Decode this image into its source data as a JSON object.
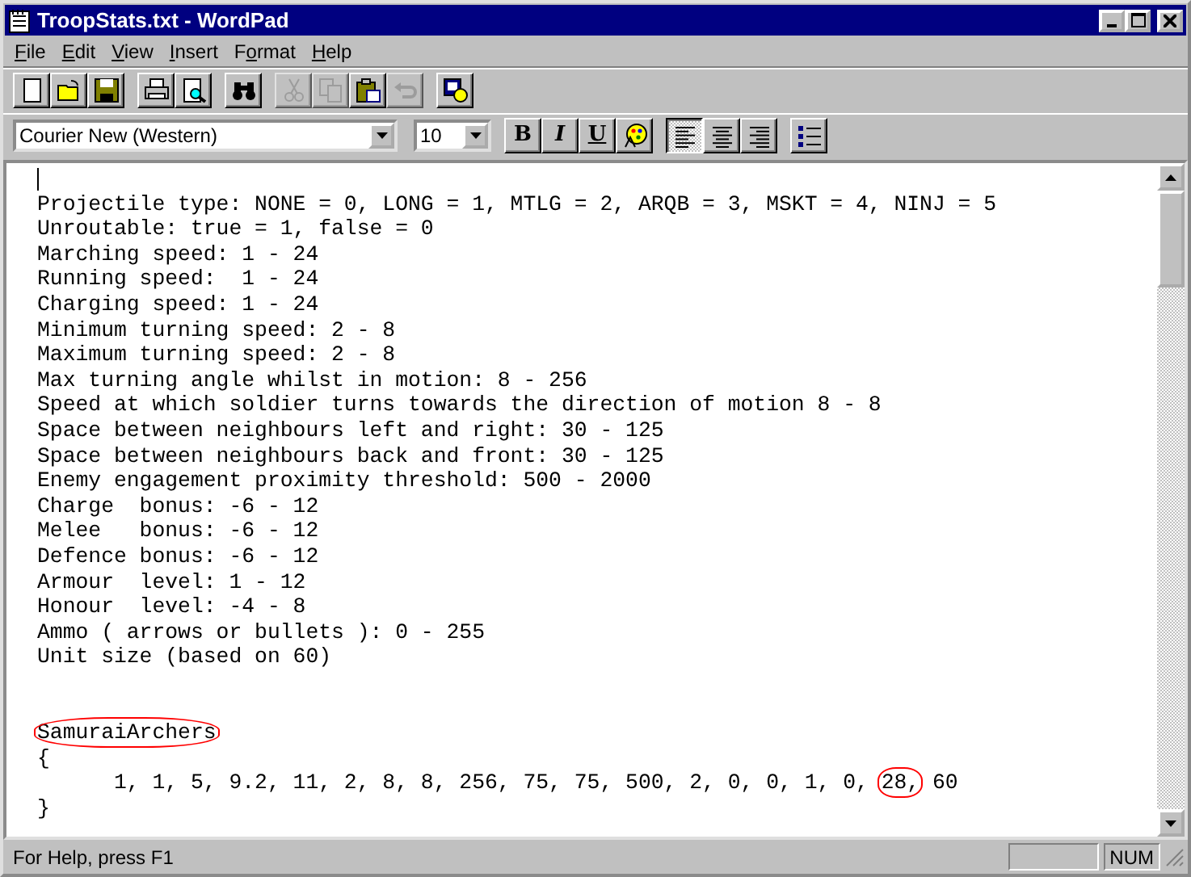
{
  "window": {
    "title": "TroopStats.txt - WordPad"
  },
  "menu": [
    {
      "accel": "F",
      "rest": "ile"
    },
    {
      "accel": "E",
      "rest": "dit"
    },
    {
      "accel": "V",
      "rest": "iew"
    },
    {
      "accel": "I",
      "rest": "nsert"
    },
    {
      "lead": "F",
      "accel": "o",
      "rest": "rmat"
    },
    {
      "accel": "H",
      "rest": "elp"
    }
  ],
  "toolbar": [
    [
      {
        "kind": "new",
        "disabled": false
      },
      {
        "kind": "open",
        "disabled": false
      },
      {
        "kind": "save",
        "disabled": false
      }
    ],
    [
      {
        "kind": "print",
        "disabled": false
      },
      {
        "kind": "preview",
        "disabled": false
      }
    ],
    [
      {
        "kind": "find",
        "disabled": false
      }
    ],
    [
      {
        "kind": "cut",
        "disabled": true
      },
      {
        "kind": "copy",
        "disabled": true
      },
      {
        "kind": "paste",
        "disabled": false
      },
      {
        "kind": "undo",
        "disabled": true
      }
    ],
    [
      {
        "kind": "datetime",
        "disabled": false
      }
    ]
  ],
  "format_bar": {
    "font": "Courier New (Western)",
    "size": "10",
    "groups": [
      [
        {
          "kind": "bold",
          "label": "B",
          "selected": false
        },
        {
          "kind": "italic",
          "label": "I",
          "selected": false
        },
        {
          "kind": "underline",
          "label": "U",
          "selected": false
        },
        {
          "kind": "color",
          "selected": false
        }
      ],
      [
        {
          "kind": "align-left",
          "selected": true
        },
        {
          "kind": "align-center",
          "selected": false
        },
        {
          "kind": "align-right",
          "selected": false
        }
      ],
      [
        {
          "kind": "bullets",
          "selected": false
        }
      ]
    ]
  },
  "document": {
    "cursor": true,
    "lines": [
      {
        "segments": [
          {
            "text": "Projectile type: NONE = 0, LONG = 1, MTLG = 2, ARQB = 3, MSKT = 4, NINJ = 5"
          }
        ]
      },
      {
        "segments": [
          {
            "text": "Unroutable: true = 1, false = 0"
          }
        ]
      },
      {
        "segments": [
          {
            "text": "Marching speed: 1 - 24"
          }
        ]
      },
      {
        "segments": [
          {
            "text": "Running speed:  1 - 24"
          }
        ]
      },
      {
        "segments": [
          {
            "text": "Charging speed: 1 - 24"
          }
        ]
      },
      {
        "segments": [
          {
            "text": "Minimum turning speed: 2 - 8"
          }
        ]
      },
      {
        "segments": [
          {
            "text": "Maximum turning speed: 2 - 8"
          }
        ]
      },
      {
        "segments": [
          {
            "text": "Max turning angle whilst in motion: 8 - 256"
          }
        ]
      },
      {
        "segments": [
          {
            "text": "Speed at which soldier turns towards the direction of motion 8 - 8"
          }
        ]
      },
      {
        "segments": [
          {
            "text": "Space between neighbours left and right: 30 - 125"
          }
        ]
      },
      {
        "segments": [
          {
            "text": "Space between neighbours back and front: 30 - 125"
          }
        ]
      },
      {
        "segments": [
          {
            "text": "Enemy engagement proximity threshold: 500 - 2000"
          }
        ]
      },
      {
        "segments": [
          {
            "text": "Charge  bonus: -6 - 12"
          }
        ]
      },
      {
        "segments": [
          {
            "text": "Melee   bonus: -6 - 12"
          }
        ]
      },
      {
        "segments": [
          {
            "text": "Defence bonus: -6 - 12"
          }
        ]
      },
      {
        "segments": [
          {
            "text": "Armour  level: 1 - 12"
          }
        ]
      },
      {
        "segments": [
          {
            "text": "Honour  level: -4 - 8"
          }
        ]
      },
      {
        "segments": [
          {
            "text": "Ammo ( arrows or bullets ): 0 - 255"
          }
        ]
      },
      {
        "segments": [
          {
            "text": "Unit size (based on 60)"
          }
        ]
      },
      {
        "blank_lines_before": true,
        "segments": [
          {
            "text": "SamuraiArchers",
            "circled": true
          }
        ]
      },
      {
        "segments": [
          {
            "text": "{"
          }
        ]
      },
      {
        "segments": [
          {
            "text": "      1, 1, 5, 9.2, 11, 2, 8, 8, 256, 75, 75, 500, 2, 0, 0, 1, 0, "
          },
          {
            "text": "28,",
            "circled": true
          },
          {
            "text": " 60"
          }
        ]
      },
      {
        "segments": [
          {
            "text": "}"
          }
        ]
      }
    ]
  },
  "status_bar": {
    "text": "For Help, press F1",
    "indicator": "NUM"
  }
}
